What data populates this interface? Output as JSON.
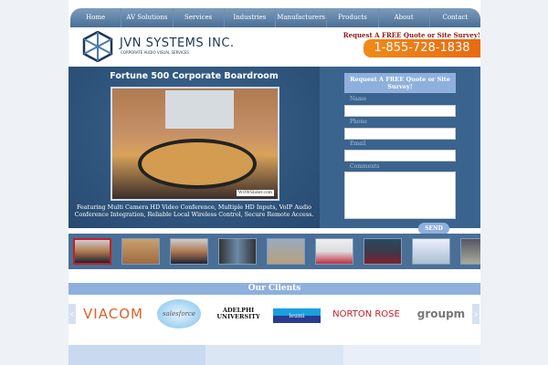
{
  "nav": [
    "Home",
    "AV Solutions",
    "Services",
    "Industries",
    "Manufacturers",
    "Products",
    "About",
    "Contact"
  ],
  "header": {
    "brand": "JVN SYSTEMS INC.",
    "tagline": "CORPORATE AUDIO VISUAL SERVICES",
    "quote_link": "Request A FREE Quote or Site Survey!",
    "phone": "1-855-728-1838"
  },
  "slide": {
    "title": "Fortune 500 Corporate Boardroom",
    "watermark": "WOWSlider.com",
    "caption": "Featuring Multi Camera HD Video Conference, Multiple HD Inputs, VoIP Audio Conference Integration, Reliable Local Wireless Control, Secure Remote Access."
  },
  "form": {
    "heading": "Request A FREE Quote or Site Survey!",
    "name_label": "Name",
    "phone_label": "Phone",
    "email_label": "Email",
    "comments_label": "Comments",
    "send": "SEND"
  },
  "clients": {
    "heading": "Our Clients",
    "logos": [
      "VIACOM",
      "salesforce",
      "ADELPHI UNIVERSITY",
      "leumi",
      "NORTON ROSE",
      "groupm"
    ],
    "prev": "‹",
    "next": "›"
  }
}
